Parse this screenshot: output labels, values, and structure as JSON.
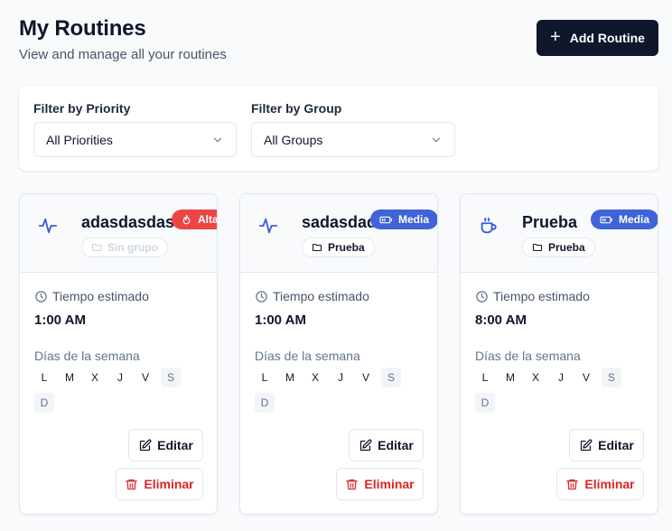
{
  "page": {
    "title": "My Routines",
    "subtitle": "View and manage all your routines",
    "add_button_label": "Add Routine"
  },
  "filters": {
    "priority": {
      "label": "Filter by Priority",
      "selected": "All Priorities"
    },
    "group": {
      "label": "Filter by Group",
      "selected": "All Groups"
    }
  },
  "routines": [
    {
      "icon": "activity-icon",
      "name": "adasdasdasd",
      "group": "Sin grupo",
      "priority": "Alta",
      "estimate_label": "Tiempo estimado",
      "estimate_value": "1:00 AM",
      "days_label": "Días de la semana",
      "days": [
        "L",
        "M",
        "X",
        "J",
        "V",
        "S",
        "D"
      ],
      "edit_label": "Editar",
      "delete_label": "Eliminar"
    },
    {
      "icon": "activity-icon",
      "name": "sadasdad",
      "group": "Prueba",
      "priority": "Media",
      "estimate_label": "Tiempo estimado",
      "estimate_value": "1:00 AM",
      "days_label": "Días de la semana",
      "days": [
        "L",
        "M",
        "X",
        "J",
        "V",
        "S",
        "D"
      ],
      "edit_label": "Editar",
      "delete_label": "Eliminar"
    },
    {
      "icon": "coffee-icon",
      "name": "Prueba",
      "group": "Prueba",
      "priority": "Media",
      "estimate_label": "Tiempo estimado",
      "estimate_value": "8:00 AM",
      "days_label": "Días de la semana",
      "days": [
        "L",
        "M",
        "X",
        "J",
        "V",
        "S",
        "D"
      ],
      "edit_label": "Editar",
      "delete_label": "Eliminar"
    }
  ]
}
